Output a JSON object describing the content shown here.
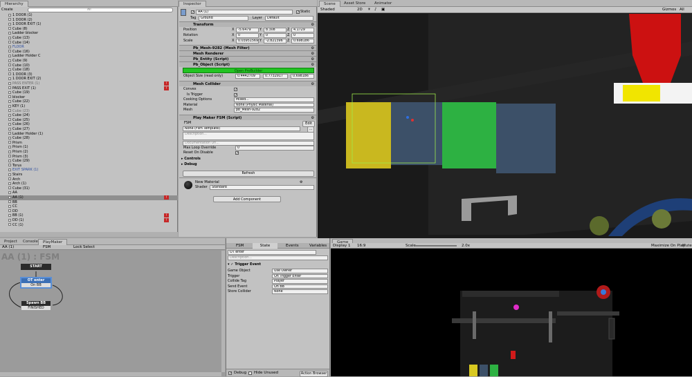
{
  "hierarchy": {
    "tab": "Hierarchy",
    "create": "Create",
    "search_hint": "All",
    "rows": [
      {
        "label": "1 DOOR (1)",
        "indent": 1,
        "style": ""
      },
      {
        "label": "1 DOOR (2)",
        "indent": 1,
        "style": ""
      },
      {
        "label": "1 DOOR EXIT (1)",
        "indent": 1,
        "style": ""
      },
      {
        "label": "Cube (8)",
        "indent": 1,
        "style": ""
      },
      {
        "label": "Ladder blocker",
        "indent": 1,
        "style": ""
      },
      {
        "label": "Cube (13)",
        "indent": 1,
        "style": ""
      },
      {
        "label": "Cube (14)",
        "indent": 1,
        "style": ""
      },
      {
        "label": "FLOOR",
        "indent": 1,
        "style": "blue"
      },
      {
        "label": "Cube (16)",
        "indent": 1,
        "style": ""
      },
      {
        "label": "Ladder Holder C",
        "indent": 1,
        "style": ""
      },
      {
        "label": "Cube (9)",
        "indent": 1,
        "style": ""
      },
      {
        "label": "Cube (10)",
        "indent": 1,
        "style": ""
      },
      {
        "label": "Cube (18)",
        "indent": 1,
        "style": ""
      },
      {
        "label": "1 DOOR (3)",
        "indent": 1,
        "style": ""
      },
      {
        "label": "1 DOOR EXIT (2)",
        "indent": 1,
        "style": ""
      },
      {
        "label": "PASS ENTER (1)",
        "indent": 1,
        "style": "grey",
        "warn": true
      },
      {
        "label": "PASS EXIT (1)",
        "indent": 1,
        "style": "",
        "warn": true
      },
      {
        "label": "Cube (19)",
        "indent": 1,
        "style": ""
      },
      {
        "label": "blocker",
        "indent": 1,
        "style": ""
      },
      {
        "label": "Cube (22)",
        "indent": 1,
        "style": ""
      },
      {
        "label": "KEY (1)",
        "indent": 1,
        "style": ""
      },
      {
        "label": "Cube (23)",
        "indent": 1,
        "style": "grey"
      },
      {
        "label": "Cube (24)",
        "indent": 1,
        "style": ""
      },
      {
        "label": "Cube (25)",
        "indent": 1,
        "style": ""
      },
      {
        "label": "Cube (26)",
        "indent": 1,
        "style": ""
      },
      {
        "label": "Cube (27)",
        "indent": 1,
        "style": ""
      },
      {
        "label": "Ladder Holder (1)",
        "indent": 1,
        "style": ""
      },
      {
        "label": "Cube (28)",
        "indent": 1,
        "style": ""
      },
      {
        "label": "Prism",
        "indent": 1,
        "style": ""
      },
      {
        "label": "Prism (1)",
        "indent": 1,
        "style": ""
      },
      {
        "label": "Prism (2)",
        "indent": 1,
        "style": ""
      },
      {
        "label": "Prism (3)",
        "indent": 1,
        "style": ""
      },
      {
        "label": "Cube (29)",
        "indent": 1,
        "style": ""
      },
      {
        "label": "Torus",
        "indent": 1,
        "style": ""
      },
      {
        "label": "EXIT SPARK (1)",
        "indent": 1,
        "style": "blue"
      },
      {
        "label": "Stairs",
        "indent": 1,
        "style": ""
      },
      {
        "label": "Arch",
        "indent": 1,
        "style": ""
      },
      {
        "label": "Arch (1)",
        "indent": 1,
        "style": ""
      },
      {
        "label": "Cube (31)",
        "indent": 1,
        "style": ""
      },
      {
        "label": "AA",
        "indent": 1,
        "style": ""
      },
      {
        "label": "AA (1)",
        "indent": 1,
        "style": "sel",
        "warn": true
      },
      {
        "label": "BB",
        "indent": 1,
        "style": ""
      },
      {
        "label": "CC",
        "indent": 1,
        "style": ""
      },
      {
        "label": "DD",
        "indent": 1,
        "style": ""
      },
      {
        "label": "BB (1)",
        "indent": 1,
        "style": "",
        "warn": true
      },
      {
        "label": "DD (1)",
        "indent": 1,
        "style": "",
        "warn": true
      },
      {
        "label": "CC (1)",
        "indent": 1,
        "style": ""
      }
    ]
  },
  "inspector": {
    "tab": "Inspector",
    "object_name": "AA (1)",
    "static_label": "Static",
    "tag_label": "Tag",
    "tag_value": "Ground",
    "layer_label": "Layer",
    "layer_value": "Default",
    "transform": {
      "title": "Transform",
      "rows": [
        {
          "label": "Position",
          "x": "-5.6479",
          "y": "8.308",
          "z": "4.1729"
        },
        {
          "label": "Rotation",
          "x": "0",
          "y": "0",
          "z": "0"
        },
        {
          "label": "Scale",
          "x": "0.03951569",
          "y": "-2.821396",
          "z": "0.698186"
        }
      ]
    },
    "components": [
      "Pb_Mesh-9282 (Mesh Filter)",
      "Mesh Renderer",
      "Pb_Entity (Script)",
      "Pb_Object (Script)"
    ],
    "probuilder_button": "Open ProBuilder",
    "object_size_label": "Object Size (read only)",
    "object_size": {
      "x": "0.4442709",
      "y": "0.7732917",
      "z": "0.698186"
    },
    "mesh_collider": {
      "title": "Mesh Collider",
      "rows": [
        {
          "label": "Convex",
          "value": "check"
        },
        {
          "label": "Is Trigger",
          "value": "check"
        },
        {
          "label": "Cooking Options",
          "value": "Mixed..."
        },
        {
          "label": "Material",
          "value": "None (Physic Material)"
        },
        {
          "label": "Mesh",
          "value": "pb_Mesh-9282"
        }
      ]
    },
    "fsm": {
      "title": "Play Maker FSM (Script)",
      "fsm_label": "FSM",
      "fsm_value": "",
      "edit": "Edit",
      "template": "None (Fsm Template)",
      "description": "Description...",
      "doc_url": "Documentation Url...",
      "max_loop": "Max Loop Override",
      "max_loop_value": "0",
      "reset": "Reset On Disable",
      "controls": "Controls",
      "debug": "Debug",
      "refresh": "Refresh"
    },
    "material": {
      "name": "New Material",
      "shader_label": "Shader",
      "shader_value": "Standard"
    },
    "add_component": "Add Component"
  },
  "scene": {
    "tabs": [
      "Scene",
      "Asset Store",
      "Animator"
    ],
    "shading": "Shaded",
    "mode_2d": "2D",
    "gizmos": "Gizmos",
    "search_hint": "All"
  },
  "playmaker": {
    "tabs": [
      "Project",
      "Console",
      "PlayMaker"
    ],
    "toolbar": [
      "AA (1)",
      "FSM",
      "Lock",
      "Select"
    ],
    "title": "AA (1) : FSM",
    "start": "START",
    "state1": "OT enter",
    "event1": "On BB",
    "state2": "Spawn BB",
    "event2": "FINISHED"
  },
  "fsm_panel": {
    "tabs": [
      "FSM",
      "State",
      "Events",
      "Variables"
    ],
    "state_name": "OT enter",
    "description": "Description...",
    "action": "Trigger Event",
    "rows": [
      {
        "label": "Game Object",
        "value": "Use Owner"
      },
      {
        "label": "Trigger",
        "value": "On Trigger Enter"
      },
      {
        "label": "Collide Tag",
        "value": "Player"
      },
      {
        "label": "Send Event",
        "value": "On BB"
      },
      {
        "label": "Store Collider",
        "value": "None"
      }
    ],
    "debug": "Debug",
    "hide_unused": "Hide Unused",
    "action_browser": "Action Browser"
  },
  "game": {
    "tab": "Game",
    "display": "Display 1",
    "aspect": "16:9",
    "scale_label": "Scale",
    "scale_value": "2.0x",
    "maximize": "Maximize On Play",
    "mute": "Mute"
  },
  "colors": {
    "accent_green": "#22c322",
    "warn_red": "#c62828",
    "node_blue": "#3b6fb5"
  }
}
